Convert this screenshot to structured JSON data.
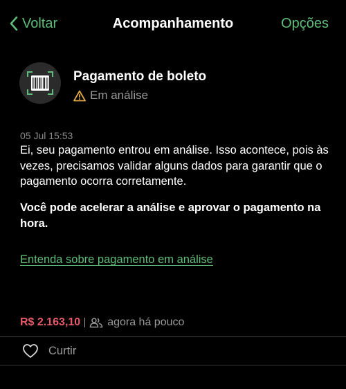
{
  "nav": {
    "back_label": "Voltar",
    "title": "Acompanhamento",
    "options_label": "Opções"
  },
  "card": {
    "title": "Pagamento de boleto",
    "icon": "barcode-icon",
    "status_icon": "warning-icon",
    "status": "Em análise"
  },
  "message": {
    "timestamp": "05 Jul 15:53",
    "body": "Ei, seu pagamento entrou em análise. Isso acontece, pois às vezes, precisamos validar alguns dados para garantir que o pagamento ocorra corretamente.",
    "highlight": "Você pode acelerar a análise e aprovar o pagamento na hora.",
    "link": "Entenda sobre pagamento em análise"
  },
  "meta": {
    "amount": "R$ 2.163,10",
    "audience_icon": "people-icon",
    "when": "agora há pouco"
  },
  "actions": {
    "like_icon": "heart-icon",
    "like_label": "Curtir"
  },
  "colors": {
    "accent": "#5fbf7a",
    "amount": "#e8596b",
    "warning": "#e0a84a",
    "background": "#000000"
  }
}
